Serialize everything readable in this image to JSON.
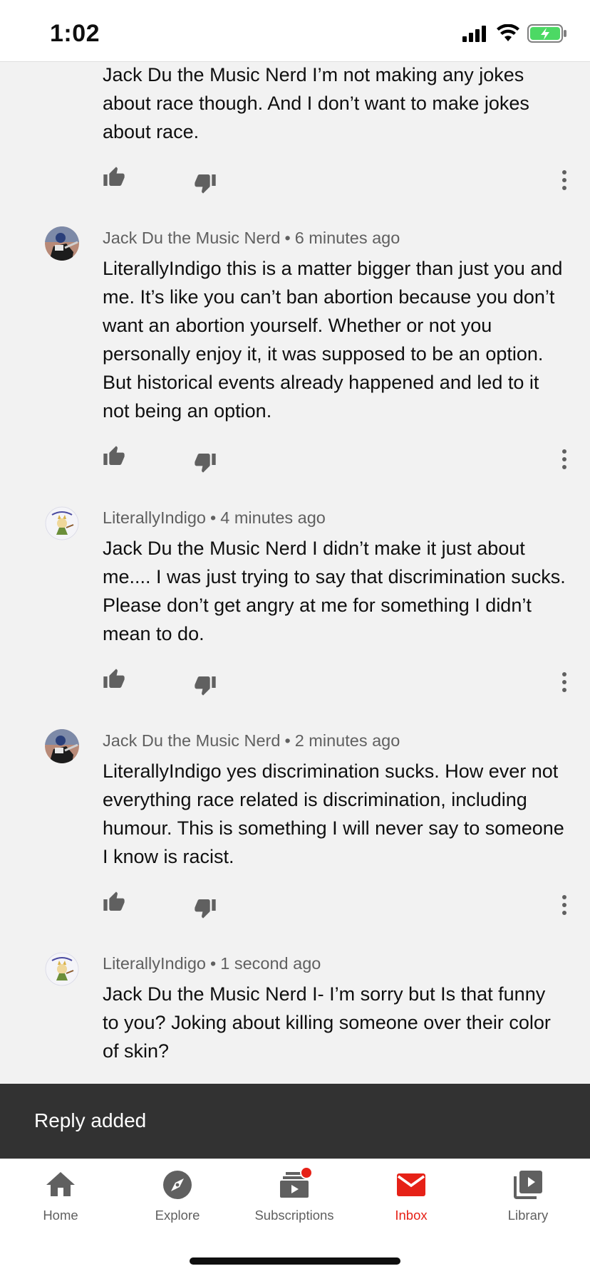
{
  "status_bar": {
    "time": "1:02",
    "battery_color": "#4cd964"
  },
  "comments": [
    {
      "author": "",
      "time": "",
      "text": "Jack Du the Music Nerd I’m not making any jokes about race though. And I don’t want to make jokes about race."
    },
    {
      "author": "Jack Du the Music Nerd",
      "time": "6 minutes ago",
      "avatar": "jack-du-avatar",
      "text": "LiterallyIndigo this is a matter bigger than just you and me. It’s like you can’t ban abortion because you don’t want an abortion yourself. Whether or not you personally enjoy it, it was supposed to be an option. But historical events already happened and led to it not being an option."
    },
    {
      "author": "LiterallyIndigo",
      "time": "4 minutes ago",
      "avatar": "literallyindigo-avatar",
      "text": "Jack Du the Music Nerd I didn’t make it just about me.... I was just trying to say that discrimination sucks. Please don’t get angry at me for something I didn’t mean to do."
    },
    {
      "author": "Jack Du the Music Nerd",
      "time": "2 minutes ago",
      "avatar": "jack-du-avatar",
      "text": "LiterallyIndigo yes discrimination sucks. How ever not everything race related is discrimination, including humour. This is something I will never say to someone I know is racist."
    },
    {
      "author": "LiterallyIndigo",
      "time": "1 second ago",
      "avatar": "literallyindigo-avatar",
      "text": "Jack Du the Music Nerd I- I’m sorry but Is that funny to you? Joking about killing someone over their color of skin?"
    }
  ],
  "meta_separator": "•",
  "snackbar": {
    "text": "Reply added"
  },
  "bottom_nav": {
    "items": [
      {
        "label": "Home",
        "icon": "home-icon"
      },
      {
        "label": "Explore",
        "icon": "compass-icon"
      },
      {
        "label": "Subscriptions",
        "icon": "subscriptions-icon",
        "badge": true
      },
      {
        "label": "Inbox",
        "icon": "mail-icon",
        "active": true
      },
      {
        "label": "Library",
        "icon": "library-icon"
      }
    ],
    "active_color": "#e62117"
  }
}
